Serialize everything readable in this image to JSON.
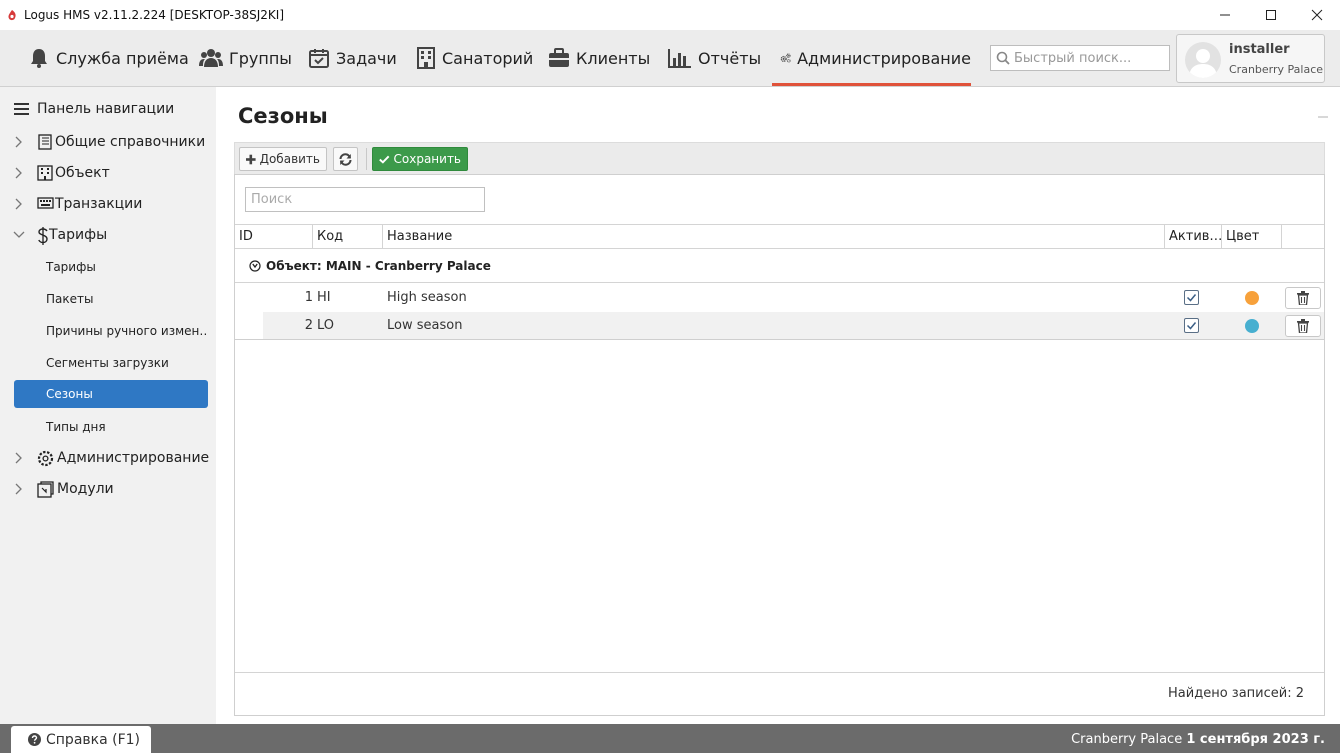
{
  "window": {
    "title": "Logus HMS v2.11.2.224 [DESKTOP-38SJ2KI]"
  },
  "mainnav": {
    "items": [
      {
        "label": "Служба приёма",
        "icon": "bell-icon"
      },
      {
        "label": "Группы",
        "icon": "users-icon"
      },
      {
        "label": "Задачи",
        "icon": "calendar-check-icon"
      },
      {
        "label": "Санаторий",
        "icon": "building-icon"
      },
      {
        "label": "Клиенты",
        "icon": "briefcase-icon"
      },
      {
        "label": "Отчёты",
        "icon": "bar-chart-icon"
      },
      {
        "label": "Администрирование",
        "icon": "gears-icon",
        "active": true
      }
    ],
    "quick_search_placeholder": "Быстрый поиск...",
    "user": {
      "name": "installer",
      "hotel": "Cranberry Palace"
    }
  },
  "sidebar": {
    "header": "Панель навигации",
    "items": [
      {
        "label": "Общие справочники"
      },
      {
        "label": "Объект"
      },
      {
        "label": "Транзакции"
      },
      {
        "label": "Тарифы",
        "expanded": true
      },
      {
        "label": "Администрирование"
      },
      {
        "label": "Модули"
      }
    ],
    "subitems": [
      {
        "label": "Тарифы"
      },
      {
        "label": "Пакеты"
      },
      {
        "label": "Причины ручного измен…"
      },
      {
        "label": "Сегменты загрузки"
      },
      {
        "label": "Сезоны",
        "active": true
      },
      {
        "label": "Типы дня"
      }
    ]
  },
  "content": {
    "title": "Сезоны",
    "toolbar": {
      "add_label": "Добавить",
      "save_label": "Сохранить"
    },
    "search_placeholder": "Поиск",
    "columns": {
      "id": "ID",
      "code": "Код",
      "name": "Название",
      "active": "Актив…",
      "color": "Цвет"
    },
    "group_label": "Объект: MAIN - Cranberry Palace",
    "rows": [
      {
        "id": "1",
        "code": "HI",
        "name": "High season",
        "active": true,
        "color": "#f7a13b"
      },
      {
        "id": "2",
        "code": "LO",
        "name": "Low season",
        "active": true,
        "color": "#47afd0"
      }
    ],
    "footer": "Найдено записей: 2"
  },
  "statusbar": {
    "help_label": "Справка (F1)",
    "hotel": "Cranberry Palace",
    "date": "1 сентября 2023 г."
  }
}
